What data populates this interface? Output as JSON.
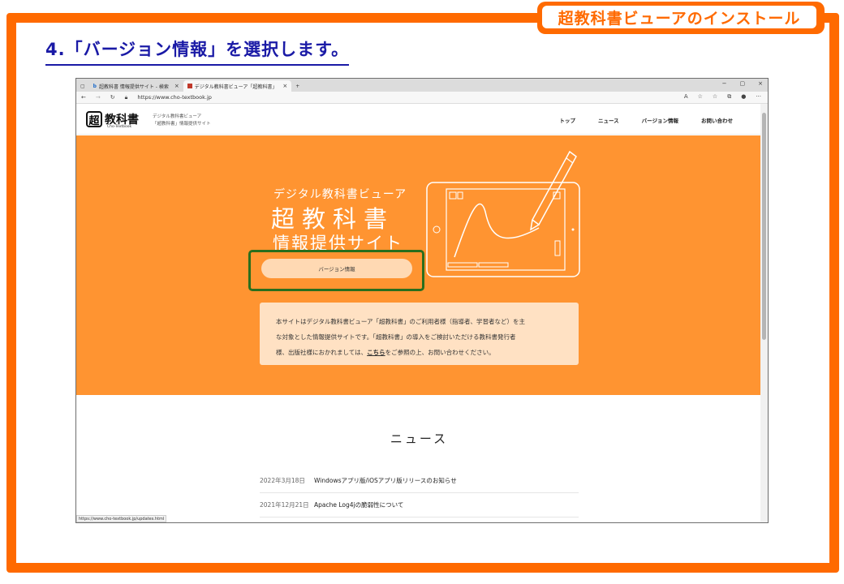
{
  "section_label": "超教科書ビューアのインストール",
  "step_title": "4.「バージョン情報」を選択します。",
  "browser": {
    "tabs": [
      {
        "label": "超教科書 情報提供サイト - 検索",
        "close": "×"
      },
      {
        "label": "デジタル教科書ビューア「超教科書」",
        "close": "×"
      }
    ],
    "new_tab": "+",
    "window_controls": [
      "−",
      "▢",
      "×"
    ],
    "url": "https://www.cho-textbook.jp",
    "status_url": "https://www.cho-textbook.jp/updates.html"
  },
  "site": {
    "logo_mark": "超",
    "logo_text": "教科書",
    "logo_sub": "Cho-Textbook",
    "logo_desc_1": "デジタル教科書ビューア",
    "logo_desc_2": "「超教科書」情報提供サイト",
    "nav": [
      "トップ",
      "ニュース",
      "バージョン情報",
      "お問い合わせ"
    ]
  },
  "hero": {
    "subtitle": "デジタル教科書ビューア",
    "title": "超教科書",
    "title2": "情報提供サイト",
    "button": "バージョン情報",
    "notice_1": "本サイトはデジタル教科書ビューア「超教科書」のご利用者様（指導者、学習者など）を主",
    "notice_2": "な対象とした情報提供サイトです。「超教科書」の導入をご検討いただける教科書発行者",
    "notice_3a": "様、出版社様におかれましては、",
    "notice_link": "こちら",
    "notice_3b": "をご参照の上、お問い合わせください。"
  },
  "news": {
    "title": "ニュース",
    "items": [
      {
        "date": "2022年3月18日",
        "text": "Windowsアプリ版/iOSアプリ版リリースのお知らせ"
      },
      {
        "date": "2021年12月21日",
        "text": "Apache Log4jの脆弱性について"
      }
    ]
  },
  "colors": {
    "frame": "#ff6a00",
    "hero": "#ff9431",
    "highlight": "#2a6e1d",
    "title": "#1a1aa6"
  }
}
